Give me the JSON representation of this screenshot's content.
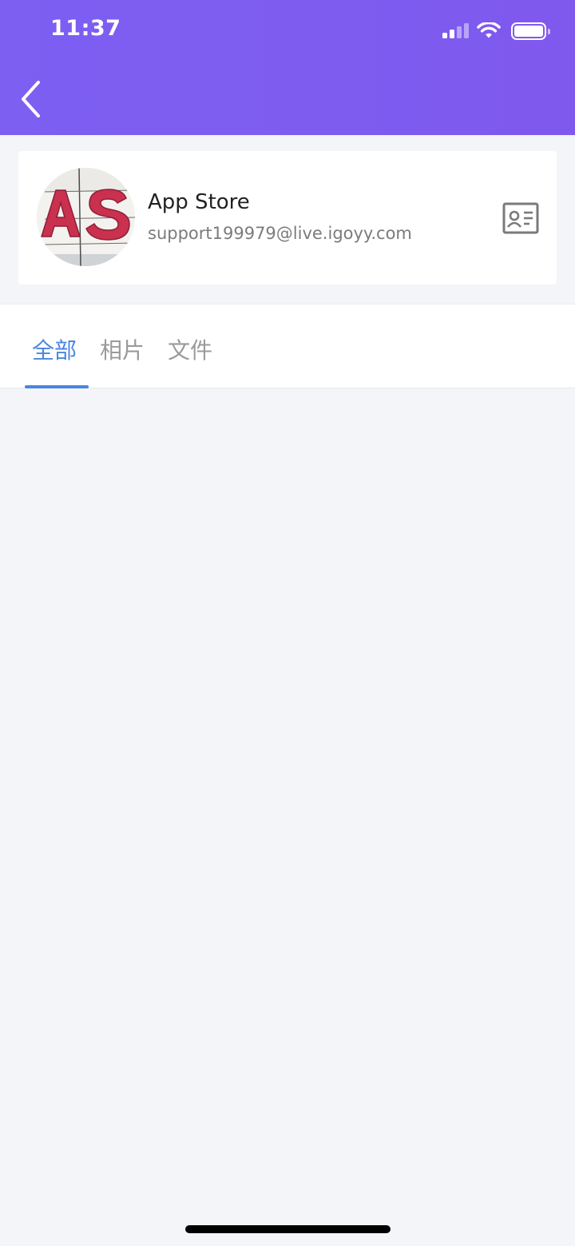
{
  "status_bar": {
    "time": "11:37"
  },
  "header": {
    "back_icon": "chevron-left-icon",
    "color": "#7e5cf0"
  },
  "contact": {
    "name": "App Store",
    "email": "support199979@live.igoyy.com",
    "avatar_letters": "AS",
    "card_icon": "contact-card-icon"
  },
  "tabs": [
    {
      "label": "全部",
      "active": true
    },
    {
      "label": "相片",
      "active": false
    },
    {
      "label": "文件",
      "active": false
    }
  ],
  "colors": {
    "accent": "#4a86e0",
    "header": "#7e5cf0",
    "background": "#f3f5f8"
  }
}
